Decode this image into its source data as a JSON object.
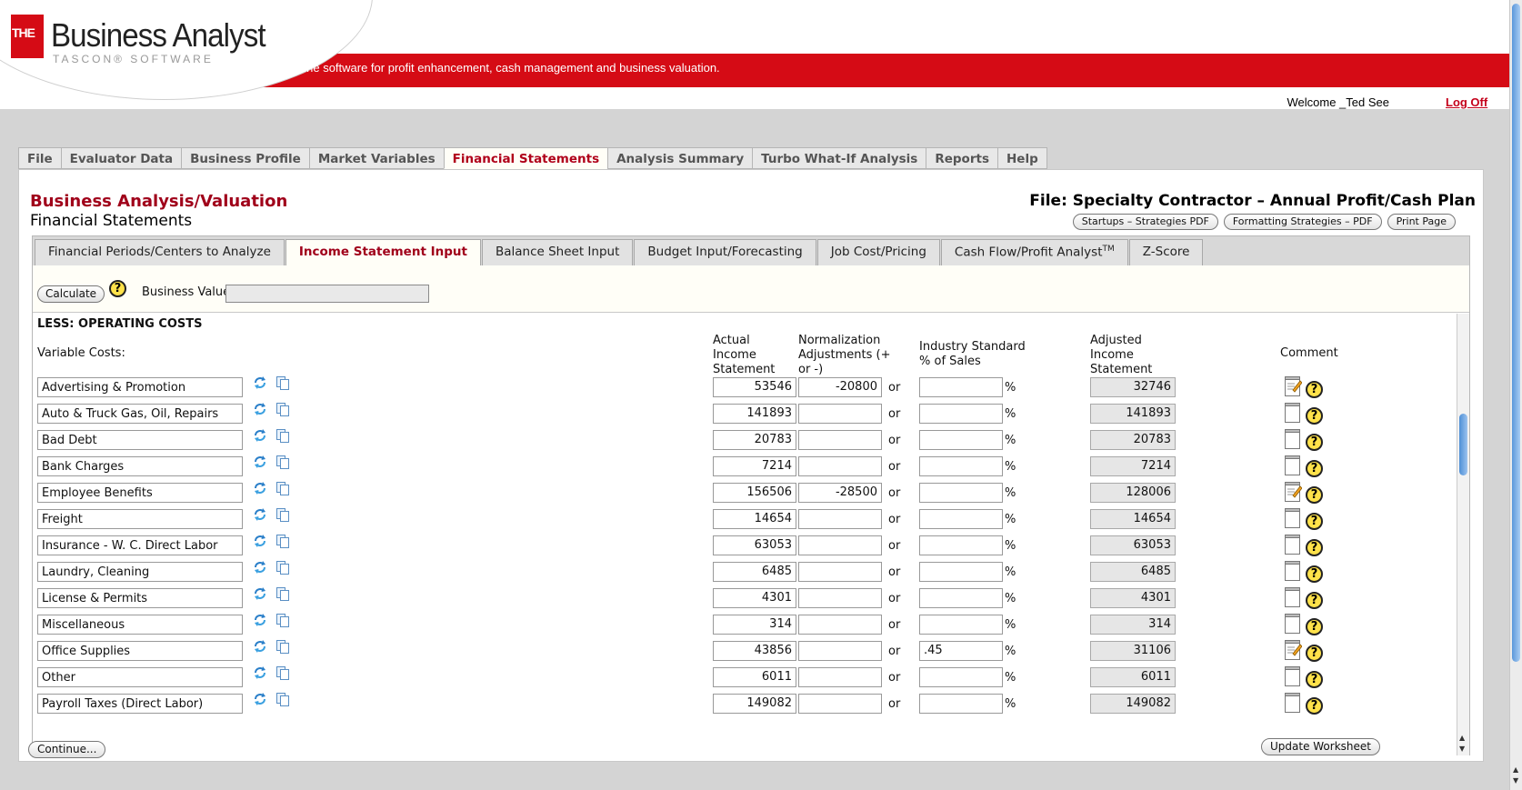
{
  "brand": {
    "the": "THE",
    "name": "Business Analyst",
    "sub": "TASCON® SOFTWARE",
    "tagline": "Online software for profit enhancement, cash management and business valuation.",
    "accent": "#d50b15"
  },
  "user": {
    "welcome": "Welcome _Ted See",
    "logoff": "Log Off"
  },
  "topnav": [
    "File",
    "Evaluator Data",
    "Business Profile",
    "Market Variables",
    "Financial Statements",
    "Analysis Summary",
    "Turbo What-If Analysis",
    "Reports",
    "Help"
  ],
  "page": {
    "title": "Business Analysis/Valuation",
    "subtitle": "Financial Statements",
    "file_title": "File: Specialty Contractor – Annual Profit/Cash Plan",
    "buttons": [
      "Startups – Strategies PDF",
      "Formatting Strategies – PDF",
      "Print Page"
    ]
  },
  "subtabs": [
    "Financial Periods/Centers to Analyze",
    "Income Statement Input",
    "Balance Sheet Input",
    "Budget Input/Forecasting",
    "Job Cost/Pricing",
    "Cash Flow/Profit Analyst",
    "Z-Score"
  ],
  "subtab_tm": "TM",
  "calc": {
    "button": "Calculate",
    "business_value_label": "Business Value:",
    "business_value": ""
  },
  "grid": {
    "section_title": "LESS: OPERATING COSTS",
    "variable_label": "Variable Costs:",
    "headers": {
      "actual": [
        "Actual",
        "Income",
        "Statement"
      ],
      "norm": [
        "Normalization",
        "Adjustments (+",
        "or -)"
      ],
      "industry": [
        "Industry Standard",
        "% of Sales"
      ],
      "adjusted": [
        "Adjusted",
        "Income",
        "Statement"
      ],
      "comment": "Comment"
    },
    "or_label": "or",
    "pct_label": "%",
    "rows": [
      {
        "name": "Advertising & Promotion",
        "actual": "53546",
        "norm": "-20800",
        "industry": "",
        "adjusted": "32746",
        "has_comment": true
      },
      {
        "name": "Auto & Truck Gas, Oil, Repairs",
        "actual": "141893",
        "norm": "",
        "industry": "",
        "adjusted": "141893",
        "has_comment": false
      },
      {
        "name": "Bad Debt",
        "actual": "20783",
        "norm": "",
        "industry": "",
        "adjusted": "20783",
        "has_comment": false
      },
      {
        "name": "Bank Charges",
        "actual": "7214",
        "norm": "",
        "industry": "",
        "adjusted": "7214",
        "has_comment": false
      },
      {
        "name": "Employee Benefits",
        "actual": "156506",
        "norm": "-28500",
        "industry": "",
        "adjusted": "128006",
        "has_comment": true
      },
      {
        "name": "Freight",
        "actual": "14654",
        "norm": "",
        "industry": "",
        "adjusted": "14654",
        "has_comment": false
      },
      {
        "name": "Insurance - W. C. Direct Labor",
        "actual": "63053",
        "norm": "",
        "industry": "",
        "adjusted": "63053",
        "has_comment": false
      },
      {
        "name": "Laundry, Cleaning",
        "actual": "6485",
        "norm": "",
        "industry": "",
        "adjusted": "6485",
        "has_comment": false
      },
      {
        "name": "License & Permits",
        "actual": "4301",
        "norm": "",
        "industry": "",
        "adjusted": "4301",
        "has_comment": false
      },
      {
        "name": "Miscellaneous",
        "actual": "314",
        "norm": "",
        "industry": "",
        "adjusted": "314",
        "has_comment": false
      },
      {
        "name": "Office Supplies",
        "actual": "43856",
        "norm": "",
        "industry": ".45",
        "adjusted": "31106",
        "has_comment": true
      },
      {
        "name": "Other",
        "actual": "6011",
        "norm": "",
        "industry": "",
        "adjusted": "6011",
        "has_comment": false
      },
      {
        "name": "Payroll Taxes (Direct Labor)",
        "actual": "149082",
        "norm": "",
        "industry": "",
        "adjusted": "149082",
        "has_comment": false
      }
    ]
  },
  "footer": {
    "continue": "Continue...",
    "update": "Update Worksheet"
  }
}
